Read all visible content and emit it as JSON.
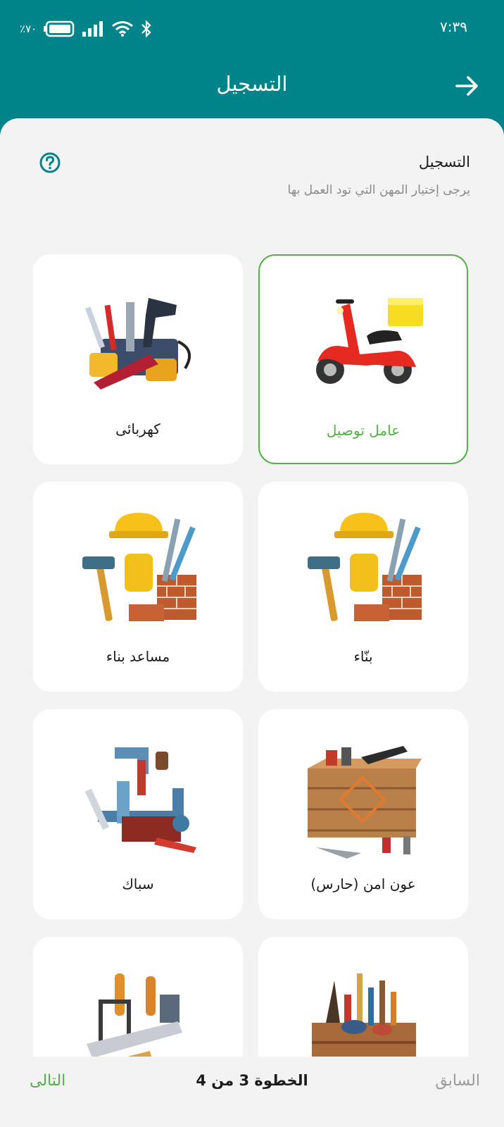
{
  "status_bar": {
    "time": "٧:٣٩",
    "battery": "٪٧٠",
    "signal_icon": "signal-icon",
    "wifi_icon": "wifi-icon",
    "bluetooth_icon": "bluetooth-icon"
  },
  "header": {
    "title": "التسجيل",
    "back_icon": "arrow-right-icon"
  },
  "intro": {
    "title": "التسجيل",
    "subtitle": "يرجى إختيار المهن التي تود العمل بها",
    "help_icon": "question-circle-icon"
  },
  "professions": [
    {
      "label": "عامل توصيل",
      "icon": "delivery-scooter-image",
      "selected": true
    },
    {
      "label": "كهربائى",
      "icon": "electric-tools-image",
      "selected": false
    },
    {
      "label": "بنّاء",
      "icon": "construction-tools-image",
      "selected": false
    },
    {
      "label": "مساعد بناء",
      "icon": "construction-tools-image",
      "selected": false
    },
    {
      "label": "عون امن (حارس)",
      "icon": "security-crate-image",
      "selected": false
    },
    {
      "label": "سباك",
      "icon": "plumbing-tools-image",
      "selected": false
    },
    {
      "label": "",
      "icon": "painting-crate-image",
      "selected": false
    },
    {
      "label": "",
      "icon": "carpentry-tools-image",
      "selected": false
    }
  ],
  "footer": {
    "previous": "السابق",
    "step": "الخطوة 3 من 4",
    "next": "التالى"
  },
  "colors": {
    "primary": "#008489",
    "accent_green": "#54b047",
    "background": "#f3f3f3"
  }
}
